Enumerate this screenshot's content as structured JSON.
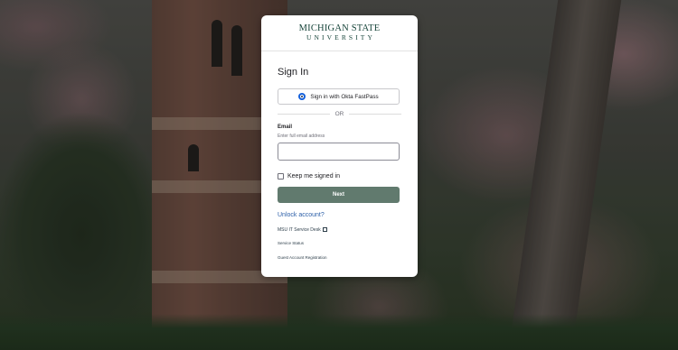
{
  "header": {
    "logo_line1": "MICHIGAN STATE",
    "logo_line2": "UNIVERSITY"
  },
  "signin": {
    "title": "Sign In",
    "fastpass_label": "Sign in with Okta FastPass",
    "or_label": "OR",
    "email_label": "Email",
    "email_hint": "Enter full email address",
    "email_value": "",
    "keep_signed_in_label": "Keep me signed in",
    "keep_signed_in_checked": false,
    "next_label": "Next"
  },
  "links": {
    "unlock": "Unlock account?",
    "service_desk": "MSU IT Service Desk",
    "service_status": "Service Status",
    "guest_registration": "Guest Account Registration"
  },
  "colors": {
    "brand_green": "#18453b",
    "next_button": "#617a6e",
    "link_blue": "#2c5fa8",
    "fastpass_icon": "#1662dd"
  }
}
